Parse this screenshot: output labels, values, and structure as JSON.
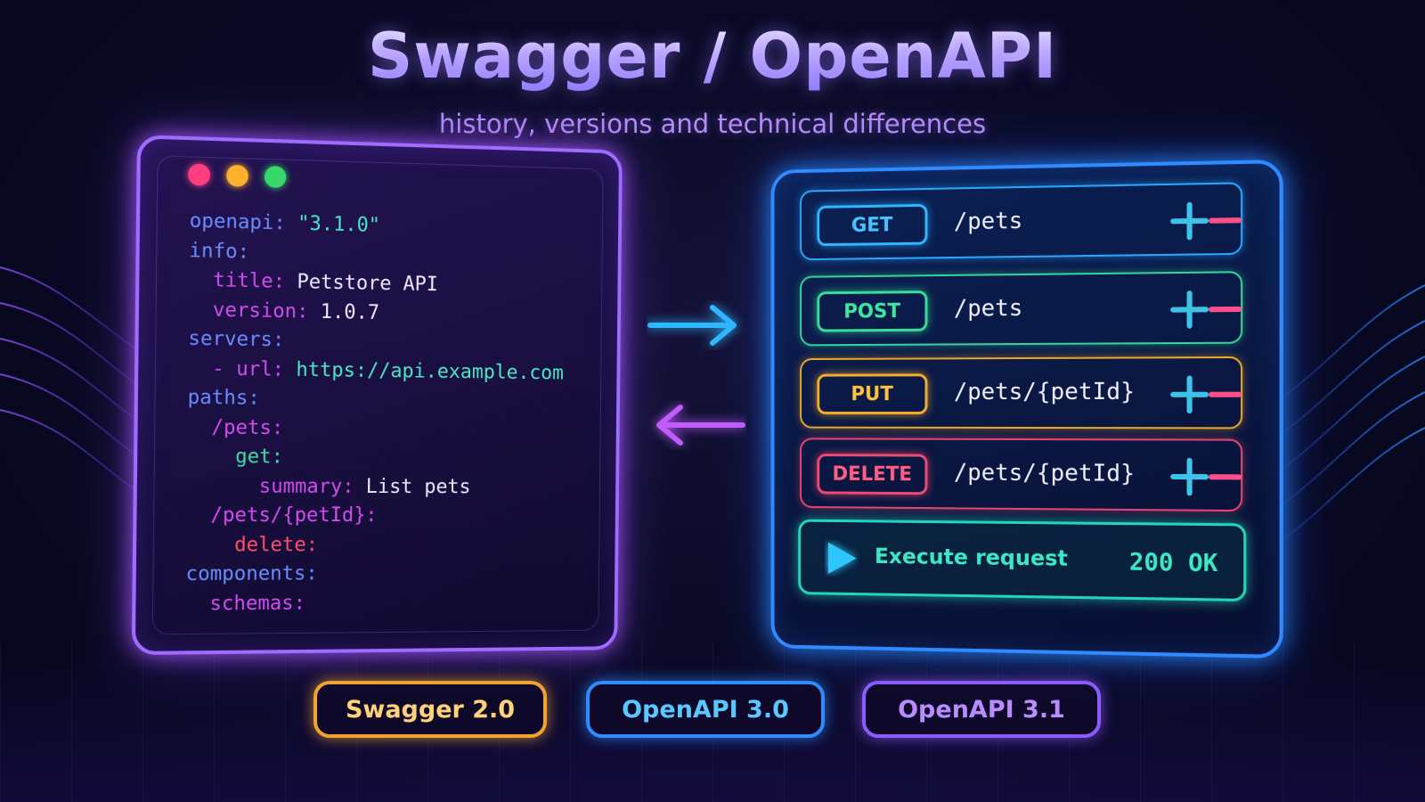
{
  "header": {
    "title": "Swagger / OpenAPI",
    "subtitle": "history, versions and technical differences"
  },
  "code_panel": {
    "window_dots": [
      "red",
      "yellow",
      "green"
    ],
    "lines": [
      {
        "indent": "",
        "key": "openapi:",
        "key_color": "#6a8cff",
        "value": " \"3.1.0\"",
        "value_color": "#46e6c8"
      },
      {
        "indent": "",
        "key": "info:",
        "key_color": "#6a8cff",
        "value": "",
        "value_color": "#eaeaff"
      },
      {
        "indent": "  ",
        "key": "title:",
        "key_color": "#d24cf0",
        "value": " Petstore API",
        "value_color": "#eaeaff"
      },
      {
        "indent": "  ",
        "key": "version:",
        "key_color": "#d24cf0",
        "value": " 1.0.7",
        "value_color": "#eaeaff"
      },
      {
        "indent": "",
        "key": "servers:",
        "key_color": "#6a8cff",
        "value": "",
        "value_color": "#eaeaff"
      },
      {
        "indent": "  ",
        "key": "- url:",
        "key_color": "#d24cf0",
        "value": " https://api.example.com",
        "value_color": "#4ee6c8"
      },
      {
        "indent": "",
        "key": "paths:",
        "key_color": "#6a8cff",
        "value": "",
        "value_color": "#eaeaff"
      },
      {
        "indent": "  ",
        "key": "/pets:",
        "key_color": "#d24cf0",
        "value": "",
        "value_color": "#eaeaff"
      },
      {
        "indent": "    ",
        "key": "get:",
        "key_color": "#3ee0a0",
        "value": "",
        "value_color": "#eaeaff"
      },
      {
        "indent": "      ",
        "key": "summary:",
        "key_color": "#d24cf0",
        "value": " List pets",
        "value_color": "#eaeaff"
      },
      {
        "indent": "  ",
        "key": "/pets/{petId}:",
        "key_color": "#d24cf0",
        "value": "",
        "value_color": "#eaeaff"
      },
      {
        "indent": "    ",
        "key": "delete:",
        "key_color": "#ff4d6d",
        "value": "",
        "value_color": "#eaeaff"
      },
      {
        "indent": "",
        "key": "components:",
        "key_color": "#6a8cff",
        "value": "",
        "value_color": "#eaeaff"
      },
      {
        "indent": "  ",
        "key": "schemas:",
        "key_color": "#d24cf0",
        "value": "",
        "value_color": "#eaeaff"
      }
    ]
  },
  "arrows": {
    "right_icon": "arrow-right-icon",
    "left_icon": "arrow-left-icon",
    "right_color": "#2fb8ff",
    "left_color": "#c35cff"
  },
  "api_panel": {
    "endpoints": [
      {
        "method": "GET",
        "path": "/pets",
        "color": "#30b6ff"
      },
      {
        "method": "POST",
        "path": "/pets",
        "color": "#3bdc98"
      },
      {
        "method": "PUT",
        "path": "/pets/{petId}",
        "color": "#f0ae2c"
      },
      {
        "method": "DELETE",
        "path": "/pets/{petId}",
        "color": "#ec4b74"
      }
    ],
    "expand_icon": "plus-minus-icon",
    "execute": {
      "icon": "play-icon",
      "label": "Execute request",
      "status": "200 OK",
      "color": "#24d6b9"
    }
  },
  "versions": {
    "items": [
      {
        "label": "Swagger 2.0",
        "color": "#f0a232"
      },
      {
        "label": "OpenAPI 3.0",
        "color": "#2e8cff"
      },
      {
        "label": "OpenAPI 3.1",
        "color": "#8a5cff"
      }
    ]
  }
}
